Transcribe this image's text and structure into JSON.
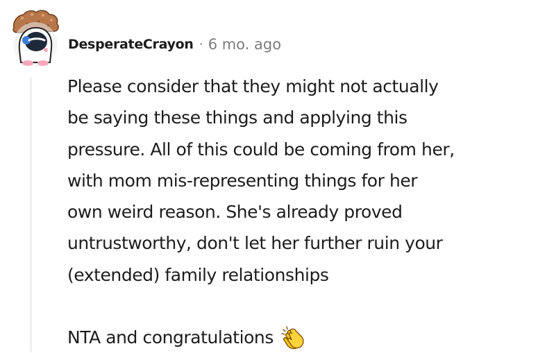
{
  "comment": {
    "username": "DesperateCrayon",
    "separator": "·",
    "timestamp": "6 mo. ago",
    "paragraph1_lines": [
      "Please consider that they might not actually",
      "be saying these things and applying this",
      "pressure. All of this could be coming from her,",
      "with mom mis-representing things for her",
      "own weird reason. She's already proved",
      "untrustworthy, don't let her further ruin your",
      "(extended) family relationships"
    ],
    "paragraph2": "NTA and congratulations",
    "emoji_icon": "clapping-hands-icon"
  },
  "colors": {
    "text": "#1c1c1c",
    "meta": "#7c7c7c",
    "thread_line": "#edeff1",
    "emoji": "#f5c518"
  }
}
